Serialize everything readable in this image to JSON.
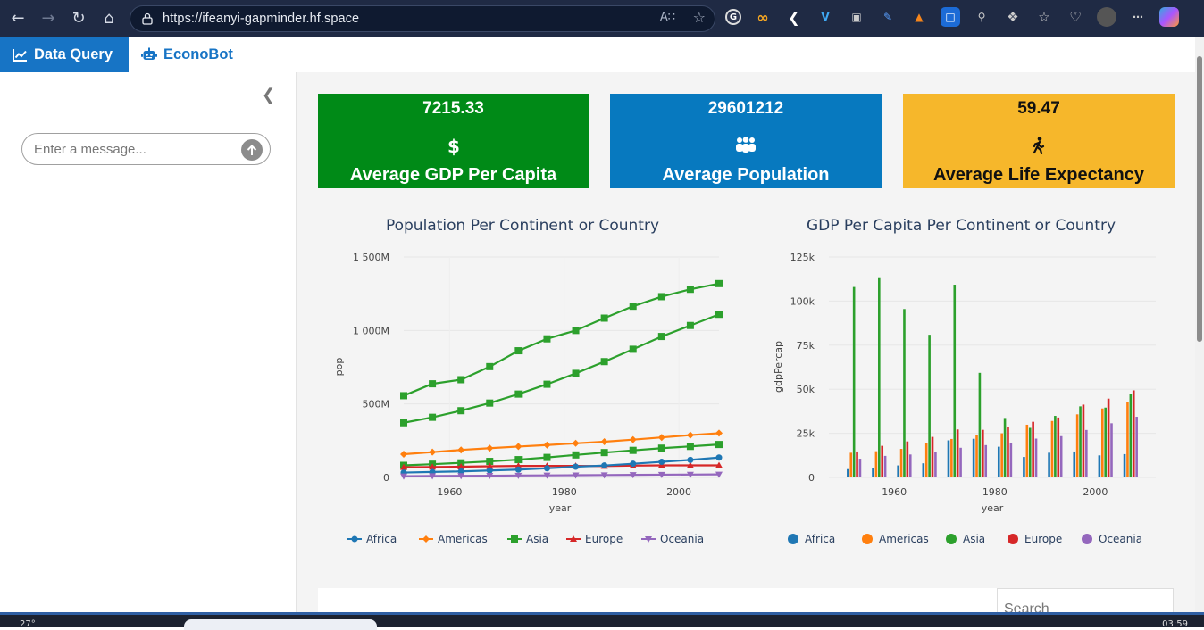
{
  "browser": {
    "url": "https://ifeanyi-gapminder.hf.space"
  },
  "tabs": [
    {
      "label": "Data Query",
      "active": true
    },
    {
      "label": "EconoBot",
      "active": false
    }
  ],
  "sidebar": {
    "message_placeholder": "Enter a message..."
  },
  "cards": [
    {
      "value": "7215.33",
      "label": "Average GDP Per Capita",
      "icon": "dollar-icon",
      "color": "#008a17"
    },
    {
      "value": "29601212",
      "label": "Average Population",
      "icon": "people-icon",
      "color": "#0779bf"
    },
    {
      "value": "59.47",
      "label": "Average Life Expectancy",
      "icon": "walking-icon",
      "color": "#f6b72b"
    }
  ],
  "chart_data": [
    {
      "type": "line",
      "title": "Population Per Continent or Country",
      "xlabel": "year",
      "ylabel": "pop",
      "xlim": [
        1952,
        2007
      ],
      "ylim": [
        0,
        1500000000
      ],
      "x_ticks": [
        1960,
        1980,
        2000
      ],
      "y_ticks": [
        0,
        500000000,
        1000000000,
        1500000000
      ],
      "y_tick_labels": [
        "0",
        "500M",
        "1 000M",
        "1 500M"
      ],
      "x": [
        1952,
        1957,
        1962,
        1967,
        1972,
        1977,
        1982,
        1987,
        1992,
        1997,
        2002,
        2007
      ],
      "legend": [
        "Africa",
        "Americas",
        "Asia",
        "Europe",
        "Oceania"
      ],
      "colors": {
        "Africa": "#1f77b4",
        "Americas": "#ff7f0e",
        "Asia": "#2ca02c",
        "Europe": "#d62728",
        "Oceania": "#9467bd"
      },
      "series": [
        {
          "name": "Asia",
          "values": [
            556000000,
            637000000,
            665000000,
            754000000,
            862000000,
            943000000,
            1000000000,
            1084000000,
            1165000000,
            1230000000,
            1280000000,
            1319000000
          ]
        },
        {
          "name": "Asia",
          "values": [
            372000000,
            409000000,
            454000000,
            506000000,
            567000000,
            634000000,
            708000000,
            788000000,
            872000000,
            959000000,
            1034000000,
            1110000000
          ]
        },
        {
          "name": "Americas",
          "values": [
            158000000,
            172000000,
            187000000,
            199000000,
            210000000,
            220000000,
            232000000,
            243000000,
            257000000,
            272000000,
            288000000,
            301000000
          ]
        },
        {
          "name": "Asia",
          "values": [
            82000000,
            90000000,
            99000000,
            109000000,
            121000000,
            136000000,
            153000000,
            169000000,
            184000000,
            199000000,
            211000000,
            224000000
          ]
        },
        {
          "name": "Europe",
          "values": [
            69000000,
            71000000,
            73000000,
            76000000,
            78000000,
            78000000,
            78000000,
            77000000,
            80000000,
            82000000,
            82000000,
            82000000
          ]
        },
        {
          "name": "Africa",
          "values": [
            33000000,
            37000000,
            41000000,
            47000000,
            53000000,
            62000000,
            73000000,
            81000000,
            93000000,
            106000000,
            119000000,
            135000000
          ]
        },
        {
          "name": "Oceania",
          "values": [
            8700000,
            9700000,
            10800000,
            11900000,
            13200000,
            14100000,
            15200000,
            16300000,
            17500000,
            18600000,
            19500000,
            20400000
          ]
        }
      ]
    },
    {
      "type": "bar",
      "title": "GDP Per Capita Per Continent or Country",
      "xlabel": "year",
      "ylabel": "gdpPercap",
      "xlim": [
        1947,
        2012
      ],
      "ylim": [
        0,
        125000
      ],
      "x_ticks": [
        1960,
        1980,
        2000
      ],
      "y_ticks": [
        0,
        25000,
        50000,
        75000,
        100000,
        125000
      ],
      "y_tick_labels": [
        "0",
        "25k",
        "50k",
        "75k",
        "100k",
        "125k"
      ],
      "categories": [
        1952,
        1957,
        1962,
        1967,
        1972,
        1977,
        1982,
        1987,
        1992,
        1997,
        2002,
        2007
      ],
      "legend": [
        "Africa",
        "Americas",
        "Asia",
        "Europe",
        "Oceania"
      ],
      "series": [
        {
          "name": "Africa",
          "values": [
            4700,
            5500,
            6800,
            8000,
            21000,
            21900,
            17400,
            11600,
            14000,
            14700,
            12500,
            13200
          ]
        },
        {
          "name": "Americas",
          "values": [
            13990,
            14850,
            16170,
            19530,
            21800,
            24070,
            25010,
            29880,
            32000,
            35770,
            39100,
            42950
          ]
        },
        {
          "name": "Asia",
          "values": [
            108000,
            113500,
            95500,
            80900,
            109300,
            59300,
            33700,
            28100,
            34900,
            40300,
            39600,
            47300
          ]
        },
        {
          "name": "Europe",
          "values": [
            14700,
            17900,
            20400,
            22970,
            27200,
            26980,
            28400,
            31540,
            33970,
            41280,
            44680,
            49360
          ]
        },
        {
          "name": "Oceania",
          "values": [
            10600,
            12200,
            13000,
            14500,
            16800,
            18300,
            19500,
            22000,
            23400,
            26900,
            30700,
            34400
          ]
        }
      ]
    }
  ],
  "bottom": {
    "search_placeholder": "Search"
  },
  "taskbar": {
    "temperature": "27°",
    "clock": "03:59"
  }
}
